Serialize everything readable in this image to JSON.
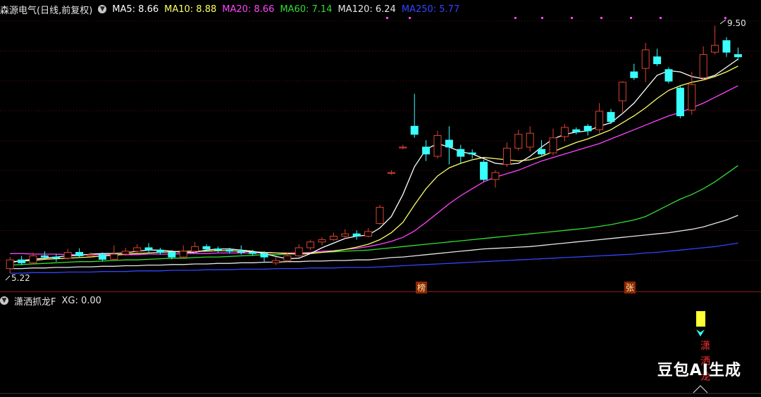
{
  "header": {
    "stock_name": "森源电气(日线,前复权)",
    "ma": [
      {
        "label": "MA5: 8.66",
        "color": "#ffffff"
      },
      {
        "label": "MA10: 8.88",
        "color": "#ffff66"
      },
      {
        "label": "MA20: 8.66",
        "color": "#ff44ff"
      },
      {
        "label": "MA60: 7.14",
        "color": "#33dd33"
      },
      {
        "label": "MA120: 6.24",
        "color": "#e6e6e6"
      },
      {
        "label": "MA250: 5.77",
        "color": "#3344ff"
      }
    ]
  },
  "sub_header": {
    "indicator": "潇洒抓龙F",
    "xg_label": "XG: 0.00"
  },
  "price_labels": {
    "high": "9.50",
    "low": "5.22"
  },
  "tags": {
    "tag1": "榜",
    "tag2": "张"
  },
  "signal_text": "潇洒龙",
  "watermark": "豆包AI生成",
  "chart_data": {
    "type": "candlestick",
    "high_label": 9.5,
    "low_label": 5.22,
    "candles": [
      [
        5.3,
        5.45,
        5.5,
        5.22
      ],
      [
        5.45,
        5.4,
        5.52,
        5.36
      ],
      [
        5.4,
        5.52,
        5.58,
        5.38
      ],
      [
        5.52,
        5.5,
        5.6,
        5.46
      ],
      [
        5.5,
        5.48,
        5.55,
        5.42
      ],
      [
        5.48,
        5.58,
        5.64,
        5.46
      ],
      [
        5.58,
        5.52,
        5.65,
        5.5
      ],
      [
        5.52,
        5.54,
        5.58,
        5.48
      ],
      [
        5.54,
        5.46,
        5.58,
        5.42
      ],
      [
        5.46,
        5.55,
        5.7,
        5.44
      ],
      [
        5.55,
        5.6,
        5.66,
        5.52
      ],
      [
        5.6,
        5.66,
        5.72,
        5.56
      ],
      [
        5.66,
        5.62,
        5.74,
        5.58
      ],
      [
        5.62,
        5.58,
        5.66,
        5.54
      ],
      [
        5.58,
        5.5,
        5.62,
        5.46
      ],
      [
        5.5,
        5.6,
        5.7,
        5.48
      ],
      [
        5.6,
        5.68,
        5.76,
        5.56
      ],
      [
        5.68,
        5.64,
        5.72,
        5.6
      ],
      [
        5.64,
        5.62,
        5.68,
        5.58
      ],
      [
        5.62,
        5.6,
        5.66,
        5.56
      ],
      [
        5.6,
        5.58,
        5.7,
        5.54
      ],
      [
        5.58,
        5.56,
        5.62,
        5.52
      ],
      [
        5.56,
        5.5,
        5.6,
        5.4
      ],
      [
        5.4,
        5.44,
        5.5,
        5.36
      ],
      [
        5.44,
        5.52,
        5.58,
        5.42
      ],
      [
        5.52,
        5.66,
        5.72,
        5.5
      ],
      [
        5.66,
        5.76,
        5.8,
        5.62
      ],
      [
        5.76,
        5.8,
        5.84,
        5.7
      ],
      [
        5.8,
        5.86,
        5.92,
        5.78
      ],
      [
        5.86,
        5.9,
        5.98,
        5.82
      ],
      [
        5.9,
        5.86,
        5.96,
        5.8
      ],
      [
        5.86,
        5.94,
        6.0,
        5.84
      ],
      [
        6.08,
        6.36,
        6.4,
        6.06
      ],
      [
        6.96,
        6.96,
        7.0,
        6.92
      ],
      [
        7.4,
        7.4,
        7.44,
        7.36
      ],
      [
        7.76,
        7.62,
        8.32,
        7.56
      ],
      [
        7.4,
        7.28,
        7.52,
        7.16
      ],
      [
        7.24,
        7.6,
        7.68,
        7.2
      ],
      [
        7.52,
        7.4,
        7.76,
        7.1
      ],
      [
        7.36,
        7.24,
        7.44,
        7.12
      ],
      [
        7.3,
        7.28,
        7.36,
        7.2
      ],
      [
        7.14,
        6.84,
        7.18,
        6.8
      ],
      [
        6.84,
        6.96,
        7.0,
        6.7
      ],
      [
        7.1,
        7.38,
        7.48,
        7.06
      ],
      [
        7.38,
        7.62,
        7.7,
        7.34
      ],
      [
        7.4,
        7.64,
        7.76,
        7.32
      ],
      [
        7.36,
        7.28,
        7.52,
        7.24
      ],
      [
        7.3,
        7.56,
        7.72,
        7.26
      ],
      [
        7.58,
        7.74,
        7.8,
        7.5
      ],
      [
        7.7,
        7.66,
        7.74,
        7.62
      ],
      [
        7.76,
        7.68,
        7.8,
        7.6
      ],
      [
        7.7,
        8.02,
        8.16,
        7.64
      ],
      [
        8.0,
        7.84,
        8.06,
        7.8
      ],
      [
        8.2,
        8.52,
        8.54,
        8.0
      ],
      [
        8.7,
        8.6,
        8.84,
        8.56
      ],
      [
        8.76,
        9.08,
        9.2,
        8.52
      ],
      [
        8.96,
        8.84,
        9.1,
        8.8
      ],
      [
        8.74,
        8.54,
        8.78,
        8.5
      ],
      [
        8.42,
        7.94,
        8.46,
        7.9
      ],
      [
        8.04,
        8.48,
        8.7,
        7.96
      ],
      [
        8.6,
        9.0,
        9.14,
        8.56
      ],
      [
        9.04,
        9.16,
        9.5,
        9.0
      ],
      [
        9.24,
        9.04,
        9.3,
        8.96
      ],
      [
        9.0,
        8.96,
        9.12,
        8.9
      ]
    ],
    "ma5": [
      5.4,
      5.44,
      5.46,
      5.48,
      5.5,
      5.52,
      5.53,
      5.55,
      5.56,
      5.56,
      5.57,
      5.6,
      5.62,
      5.62,
      5.6,
      5.58,
      5.58,
      5.62,
      5.64,
      5.64,
      5.62,
      5.6,
      5.56,
      5.51,
      5.47,
      5.48,
      5.56,
      5.66,
      5.74,
      5.82,
      5.86,
      5.88,
      6.0,
      6.2,
      6.58,
      7.06,
      7.36,
      7.46,
      7.4,
      7.32,
      7.28,
      7.2,
      7.12,
      7.1,
      7.12,
      7.24,
      7.4,
      7.54,
      7.62,
      7.66,
      7.68,
      7.76,
      7.82,
      7.98,
      8.16,
      8.4,
      8.64,
      8.72,
      8.7,
      8.62,
      8.58,
      8.64,
      8.78,
      8.92
    ],
    "ma10": [
      5.42,
      5.43,
      5.44,
      5.46,
      5.47,
      5.48,
      5.49,
      5.5,
      5.52,
      5.53,
      5.55,
      5.56,
      5.57,
      5.58,
      5.59,
      5.6,
      5.6,
      5.6,
      5.61,
      5.61,
      5.6,
      5.59,
      5.58,
      5.57,
      5.56,
      5.55,
      5.56,
      5.58,
      5.6,
      5.63,
      5.67,
      5.72,
      5.8,
      5.92,
      6.1,
      6.4,
      6.68,
      6.9,
      7.04,
      7.12,
      7.18,
      7.22,
      7.2,
      7.18,
      7.16,
      7.18,
      7.24,
      7.32,
      7.4,
      7.48,
      7.54,
      7.62,
      7.7,
      7.82,
      7.94,
      8.08,
      8.24,
      8.38,
      8.46,
      8.52,
      8.56,
      8.62,
      8.7,
      8.8
    ],
    "ma20": [
      5.56,
      5.56,
      5.55,
      5.55,
      5.55,
      5.54,
      5.54,
      5.54,
      5.54,
      5.54,
      5.54,
      5.54,
      5.55,
      5.55,
      5.55,
      5.56,
      5.56,
      5.56,
      5.57,
      5.57,
      5.57,
      5.57,
      5.57,
      5.57,
      5.57,
      5.57,
      5.58,
      5.6,
      5.61,
      5.63,
      5.65,
      5.68,
      5.72,
      5.77,
      5.84,
      5.95,
      6.1,
      6.26,
      6.42,
      6.56,
      6.68,
      6.8,
      6.88,
      6.94,
      7.0,
      7.08,
      7.16,
      7.22,
      7.28,
      7.34,
      7.4,
      7.46,
      7.54,
      7.62,
      7.7,
      7.78,
      7.86,
      7.94,
      8.0,
      8.08,
      8.16,
      8.26,
      8.36,
      8.46
    ],
    "ma60": [
      5.36,
      5.37,
      5.38,
      5.39,
      5.4,
      5.41,
      5.42,
      5.42,
      5.43,
      5.44,
      5.45,
      5.45,
      5.46,
      5.47,
      5.48,
      5.48,
      5.49,
      5.5,
      5.5,
      5.51,
      5.52,
      5.53,
      5.54,
      5.54,
      5.55,
      5.56,
      5.57,
      5.58,
      5.59,
      5.6,
      5.61,
      5.62,
      5.64,
      5.66,
      5.68,
      5.7,
      5.72,
      5.74,
      5.76,
      5.78,
      5.8,
      5.82,
      5.84,
      5.86,
      5.88,
      5.9,
      5.92,
      5.94,
      5.96,
      5.98,
      6.0,
      6.03,
      6.06,
      6.1,
      6.14,
      6.2,
      6.3,
      6.4,
      6.5,
      6.58,
      6.68,
      6.8,
      6.94,
      7.08
    ],
    "ma120": [
      5.3,
      5.3,
      5.31,
      5.31,
      5.32,
      5.32,
      5.33,
      5.33,
      5.34,
      5.34,
      5.35,
      5.35,
      5.36,
      5.36,
      5.37,
      5.37,
      5.38,
      5.38,
      5.39,
      5.39,
      5.4,
      5.4,
      5.41,
      5.41,
      5.42,
      5.42,
      5.43,
      5.43,
      5.44,
      5.44,
      5.45,
      5.45,
      5.47,
      5.49,
      5.5,
      5.52,
      5.54,
      5.56,
      5.58,
      5.6,
      5.62,
      5.64,
      5.65,
      5.66,
      5.67,
      5.68,
      5.7,
      5.72,
      5.74,
      5.76,
      5.78,
      5.8,
      5.82,
      5.84,
      5.86,
      5.88,
      5.9,
      5.92,
      5.95,
      5.98,
      6.02,
      6.08,
      6.14,
      6.22
    ],
    "ma250": [
      5.22,
      5.22,
      5.23,
      5.23,
      5.23,
      5.24,
      5.24,
      5.24,
      5.25,
      5.25,
      5.25,
      5.26,
      5.26,
      5.26,
      5.27,
      5.27,
      5.27,
      5.28,
      5.28,
      5.28,
      5.29,
      5.29,
      5.29,
      5.3,
      5.3,
      5.3,
      5.31,
      5.31,
      5.31,
      5.32,
      5.32,
      5.32,
      5.33,
      5.34,
      5.35,
      5.36,
      5.37,
      5.38,
      5.39,
      5.4,
      5.41,
      5.42,
      5.43,
      5.44,
      5.45,
      5.46,
      5.47,
      5.48,
      5.49,
      5.5,
      5.51,
      5.52,
      5.53,
      5.54,
      5.55,
      5.57,
      5.58,
      5.6,
      5.62,
      5.64,
      5.66,
      5.68,
      5.71,
      5.74
    ],
    "colors": {
      "up": "#d9442e",
      "down": "#39ffff",
      "ma5": "#ffffff",
      "ma10": "#ffff66",
      "ma20": "#ff44ff",
      "ma60": "#33dd33",
      "ma120": "#e6e6e6",
      "ma250": "#3344ff"
    }
  }
}
